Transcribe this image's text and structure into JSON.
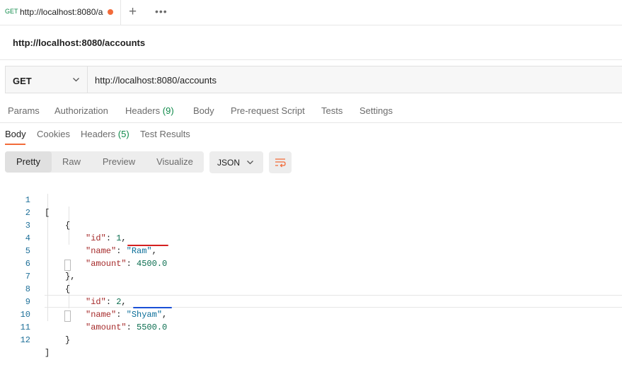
{
  "tabs": [
    {
      "method": "GET",
      "title": "http://localhost:8080/a",
      "unsaved": true
    }
  ],
  "request": {
    "name": "http://localhost:8080/accounts",
    "method": "GET",
    "url": "http://localhost:8080/accounts",
    "tabs": {
      "params": "Params",
      "authorization": "Authorization",
      "headers": "Headers",
      "headers_count": "(9)",
      "body": "Body",
      "prerequest": "Pre-request Script",
      "tests": "Tests",
      "settings": "Settings"
    }
  },
  "response": {
    "tabs": {
      "body": "Body",
      "cookies": "Cookies",
      "headers": "Headers",
      "headers_count": "(5)",
      "test_results": "Test Results"
    },
    "views": {
      "pretty": "Pretty",
      "raw": "Raw",
      "preview": "Preview",
      "visualize": "Visualize"
    },
    "format": "JSON",
    "json": [
      {
        "id": "1",
        "name": "\"Ram\"",
        "amount": "4500.0"
      },
      {
        "id": "2",
        "name": "\"Shyam\"",
        "amount": "5500.0"
      }
    ],
    "line_numbers": [
      "1",
      "2",
      "3",
      "4",
      "5",
      "6",
      "7",
      "8",
      "9",
      "10",
      "11",
      "12"
    ]
  },
  "colors": {
    "accent": "#f26b3a",
    "count_green": "#0f8a4a",
    "mark_red": "#d42020",
    "mark_blue": "#1a4fd6"
  }
}
